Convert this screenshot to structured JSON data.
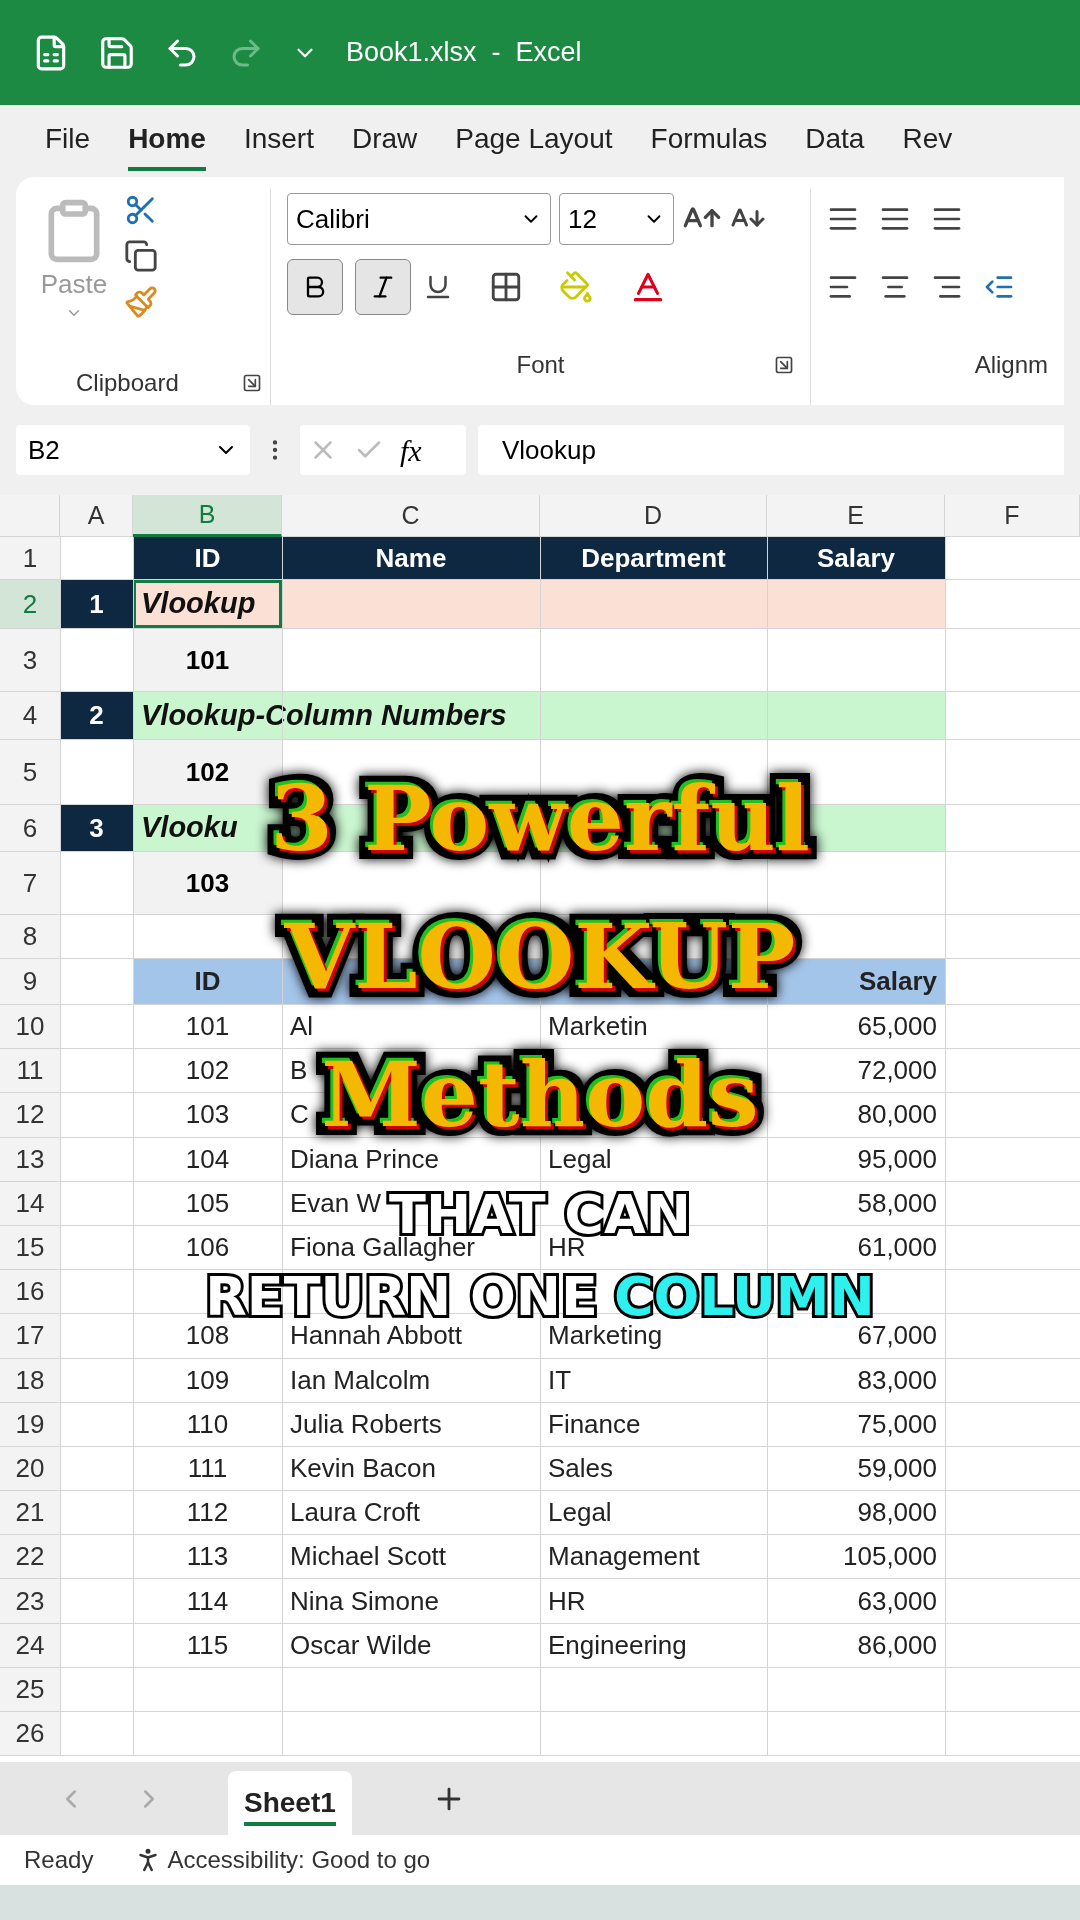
{
  "window": {
    "title": "Book1.xlsx  -  Excel"
  },
  "tabs": [
    {
      "label": "File",
      "selected": false
    },
    {
      "label": "Home",
      "selected": true
    },
    {
      "label": "Insert",
      "selected": false
    },
    {
      "label": "Draw",
      "selected": false
    },
    {
      "label": "Page Layout",
      "selected": false
    },
    {
      "label": "Formulas",
      "selected": false
    },
    {
      "label": "Data",
      "selected": false
    },
    {
      "label": "Rev",
      "selected": false
    }
  ],
  "ribbon": {
    "paste_label": "Paste",
    "clipboard_label": "Clipboard",
    "font_name": "Calibri",
    "font_size": "12",
    "font_label": "Font",
    "alignment_label": "Alignm",
    "bold": true,
    "italic": true
  },
  "formula_bar": {
    "name_box": "B2",
    "fx": "fx",
    "formula": "Vlookup"
  },
  "columns": [
    {
      "label": "A",
      "selected": false
    },
    {
      "label": "B",
      "selected": true
    },
    {
      "label": "C",
      "selected": false
    },
    {
      "label": "D",
      "selected": false
    },
    {
      "label": "E",
      "selected": false
    },
    {
      "label": "F",
      "selected": false
    }
  ],
  "rows": [
    {
      "num": "1",
      "kind": "title_header",
      "selected": false,
      "cells": [
        "ID",
        "Name",
        "Department",
        "Salary"
      ]
    },
    {
      "num": "2",
      "kind": "section",
      "selected": true,
      "badge": "1",
      "title": "Vlookup",
      "color": "#fbe0d6"
    },
    {
      "num": "3",
      "kind": "lookup",
      "selected": false,
      "value": "101"
    },
    {
      "num": "4",
      "kind": "section",
      "selected": false,
      "badge": "2",
      "title": "Vlookup-Column Numbers",
      "color": "#c9f5cf"
    },
    {
      "num": "5",
      "kind": "lookup",
      "selected": false,
      "value": "102"
    },
    {
      "num": "6",
      "kind": "section",
      "selected": false,
      "badge": "3",
      "title": "Vlooku",
      "color": "#c9f5cf"
    },
    {
      "num": "7",
      "kind": "lookup",
      "selected": false,
      "value": "103"
    },
    {
      "num": "8",
      "kind": "blank",
      "selected": false
    },
    {
      "num": "9",
      "kind": "table_header",
      "selected": false,
      "cells": [
        "ID",
        "",
        "",
        "Salary"
      ]
    },
    {
      "num": "10",
      "kind": "data",
      "selected": false,
      "cells": [
        "101",
        "Al",
        "Marketin",
        "65,000"
      ]
    },
    {
      "num": "11",
      "kind": "data",
      "selected": false,
      "cells": [
        "102",
        "B",
        "",
        "72,000"
      ]
    },
    {
      "num": "12",
      "kind": "data",
      "selected": false,
      "cells": [
        "103",
        "C",
        "",
        "80,000"
      ]
    },
    {
      "num": "13",
      "kind": "data",
      "selected": false,
      "cells": [
        "104",
        "Diana Prince",
        "Legal",
        "95,000"
      ]
    },
    {
      "num": "14",
      "kind": "data",
      "selected": false,
      "cells": [
        "105",
        "Evan W",
        "",
        "58,000"
      ]
    },
    {
      "num": "15",
      "kind": "data",
      "selected": false,
      "cells": [
        "106",
        "Fiona Gallagher",
        "HR",
        "61,000"
      ]
    },
    {
      "num": "16",
      "kind": "data",
      "selected": false,
      "cells": [
        "",
        "",
        "",
        ""
      ]
    },
    {
      "num": "17",
      "kind": "data",
      "selected": false,
      "cells": [
        "108",
        "Hannah Abbott",
        "Marketing",
        "67,000"
      ]
    },
    {
      "num": "18",
      "kind": "data",
      "selected": false,
      "cells": [
        "109",
        "Ian Malcolm",
        "IT",
        "83,000"
      ]
    },
    {
      "num": "19",
      "kind": "data",
      "selected": false,
      "cells": [
        "110",
        "Julia Roberts",
        "Finance",
        "75,000"
      ]
    },
    {
      "num": "20",
      "kind": "data",
      "selected": false,
      "cells": [
        "111",
        "Kevin Bacon",
        "Sales",
        "59,000"
      ]
    },
    {
      "num": "21",
      "kind": "data",
      "selected": false,
      "cells": [
        "112",
        "Laura Croft",
        "Legal",
        "98,000"
      ]
    },
    {
      "num": "22",
      "kind": "data",
      "selected": false,
      "cells": [
        "113",
        "Michael Scott",
        "Management",
        "105,000"
      ]
    },
    {
      "num": "23",
      "kind": "data",
      "selected": false,
      "cells": [
        "114",
        "Nina Simone",
        "HR",
        "63,000"
      ]
    },
    {
      "num": "24",
      "kind": "data",
      "selected": false,
      "cells": [
        "115",
        "Oscar Wilde",
        "Engineering",
        "86,000"
      ]
    },
    {
      "num": "25",
      "kind": "blank",
      "selected": false
    },
    {
      "num": "26",
      "kind": "blank",
      "selected": false
    }
  ],
  "sheet_tabs": [
    {
      "label": "Sheet1",
      "selected": true
    }
  ],
  "status_bar": {
    "state": "Ready",
    "accessibility": "Accessibility: Good to go"
  },
  "overlay": {
    "title_lines": [
      "3 Powerful",
      "VLOOKUP",
      "Methods"
    ],
    "caption_lines": [
      [
        {
          "text": "THAT CAN",
          "highlight": false
        }
      ],
      [
        {
          "text": "RETURN ONE",
          "highlight": false
        },
        {
          "text": "COLUMN",
          "highlight": true
        }
      ]
    ]
  }
}
